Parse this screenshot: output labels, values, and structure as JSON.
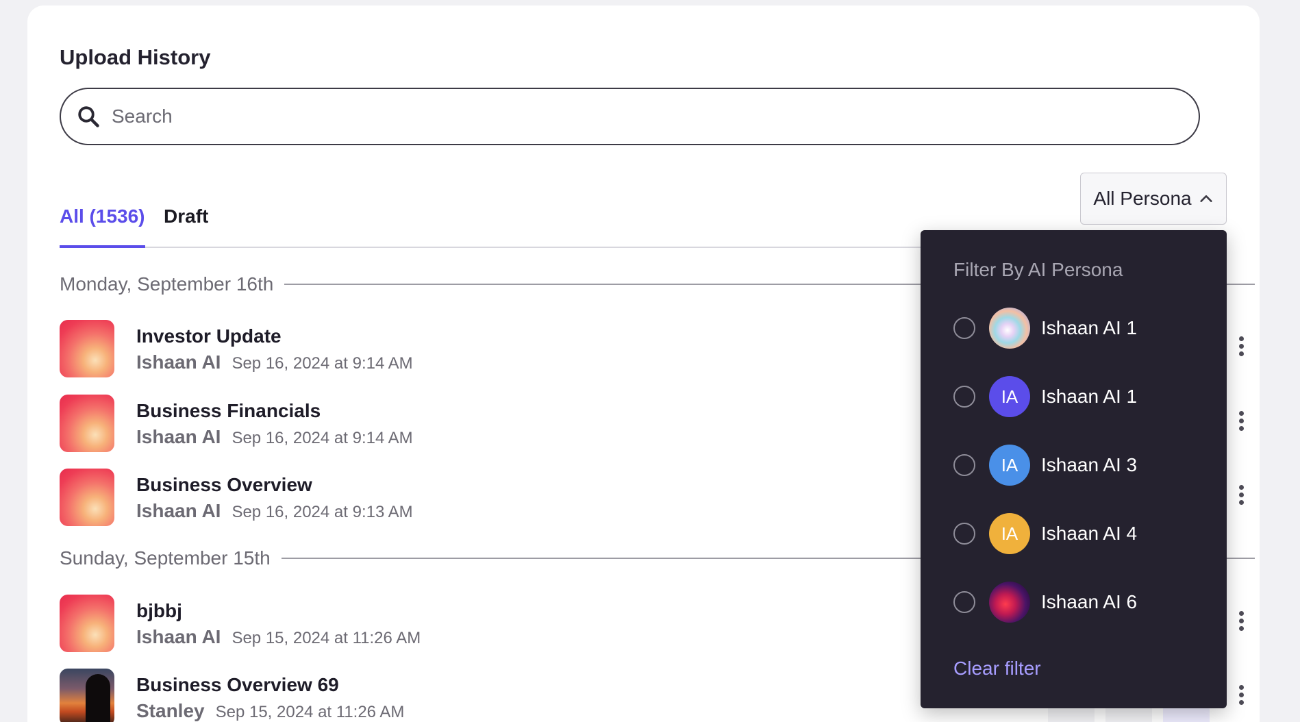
{
  "page": {
    "title": "Upload History"
  },
  "search": {
    "placeholder": "Search"
  },
  "tabs": [
    {
      "label": "All (1536)",
      "active": true
    },
    {
      "label": "Draft",
      "active": false
    }
  ],
  "persona_filter": {
    "label": "All Persona"
  },
  "groups": [
    {
      "date_label": "Monday, September 16th",
      "items": [
        {
          "title": "Investor Update",
          "author": "Ishaan AI",
          "date": "Sep 16, 2024 at 9:14 AM"
        },
        {
          "title": "Business Financials",
          "author": "Ishaan AI",
          "date": "Sep 16, 2024 at 9:14 AM"
        },
        {
          "title": "Business Overview",
          "author": "Ishaan AI",
          "date": "Sep 16, 2024 at 9:13 AM"
        }
      ]
    },
    {
      "date_label": "Sunday, September 15th",
      "items": [
        {
          "title": "bjbbj",
          "author": "Ishaan AI",
          "date": "Sep 15, 2024 at 11:26 AM"
        },
        {
          "title": "Business Overview 69",
          "author": "Stanley",
          "date": "Sep 15, 2024 at 11:26 AM"
        }
      ]
    }
  ],
  "dropdown": {
    "title": "Filter By AI Persona",
    "options": [
      {
        "name": "Ishaan AI 1",
        "avatar_type": "image",
        "avatar_text": ""
      },
      {
        "name": "Ishaan AI 1",
        "avatar_type": "initials",
        "avatar_text": "IA",
        "color": "#5b4dea"
      },
      {
        "name": "Ishaan AI 3",
        "avatar_type": "initials",
        "avatar_text": "IA",
        "color": "#4a90e8"
      },
      {
        "name": "Ishaan AI 4",
        "avatar_type": "initials",
        "avatar_text": "IA",
        "color": "#f0b13c"
      },
      {
        "name": "Ishaan AI 6",
        "avatar_type": "image",
        "avatar_text": ""
      }
    ],
    "clear_label": "Clear filter"
  },
  "colors": {
    "accent": "#5b4dea",
    "dropdown_bg": "#25222f",
    "link": "#a79dff"
  }
}
